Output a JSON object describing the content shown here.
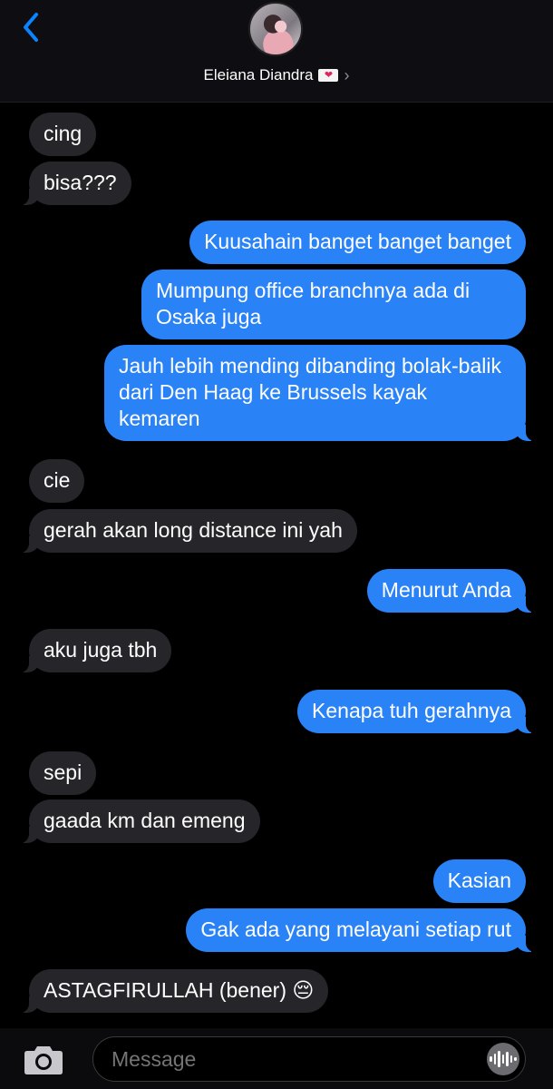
{
  "header": {
    "contact_name": "Eleiana Diandra",
    "badge_icon": "heart-letter-icon",
    "back_icon": "chevron-left-icon",
    "details_icon": "chevron-right-icon"
  },
  "messages": [
    {
      "side": "incoming",
      "text": "cing"
    },
    {
      "side": "incoming",
      "text": "bisa???"
    },
    {
      "side": "outgoing",
      "text": "Kuusahain banget banget banget"
    },
    {
      "side": "outgoing",
      "text": "Mumpung office branchnya ada di Osaka juga"
    },
    {
      "side": "outgoing",
      "text": "Jauh lebih mending dibanding bolak-balik dari Den Haag ke Brussels kayak kemaren"
    },
    {
      "side": "incoming",
      "text": "cie"
    },
    {
      "side": "incoming",
      "text": "gerah akan long distance ini yah"
    },
    {
      "side": "outgoing",
      "text": "Menurut Anda"
    },
    {
      "side": "incoming",
      "text": "aku juga tbh"
    },
    {
      "side": "outgoing",
      "text": "Kenapa tuh gerahnya"
    },
    {
      "side": "incoming",
      "text": "sepi"
    },
    {
      "side": "incoming",
      "text": "gaada km dan emeng"
    },
    {
      "side": "outgoing",
      "text": "Kasian"
    },
    {
      "side": "outgoing",
      "text": "Gak ada yang melayani setiap rut"
    },
    {
      "side": "incoming",
      "text": "ASTAGFIRULLAH (bener) 😔"
    }
  ],
  "composer": {
    "placeholder": "Message",
    "camera_icon": "camera-icon",
    "audio_icon": "audio-waveform-icon"
  },
  "colors": {
    "incoming_bubble": "#26252a",
    "outgoing_bubble": "#2a82f7",
    "accent": "#0a84ff"
  }
}
